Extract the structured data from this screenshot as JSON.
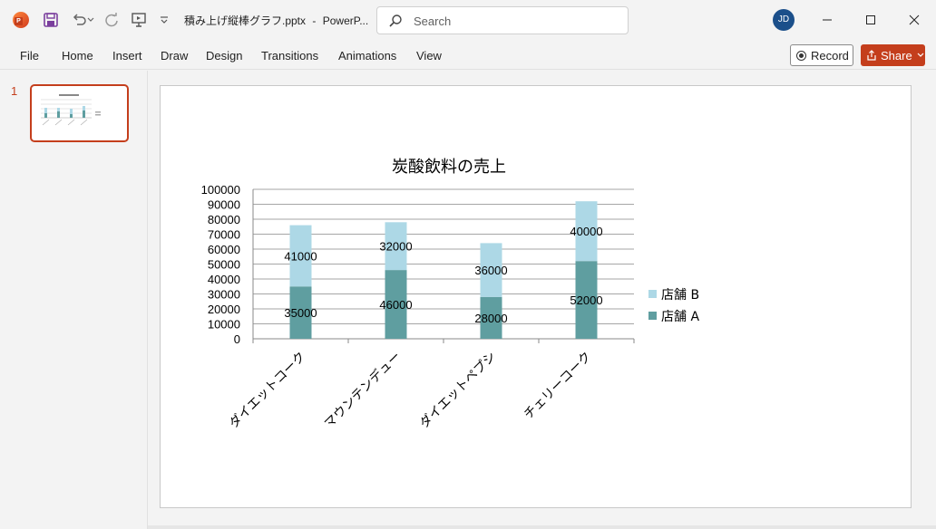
{
  "app": {
    "file_name": "積み上げ縦棒グラフ.pptx",
    "separator": "-",
    "app_name": "PowerP...",
    "user_initials": "JD"
  },
  "search": {
    "placeholder": "Search"
  },
  "ribbon": {
    "tabs": [
      "File",
      "Home",
      "Insert",
      "Draw",
      "Design",
      "Transitions",
      "Animations",
      "View"
    ],
    "record_label": "Record",
    "share_label": "Share"
  },
  "thumbnails": [
    {
      "number": "1"
    }
  ],
  "colors": {
    "accent": "#c43e1c",
    "series_a": "#5f9ea0",
    "series_b": "#add8e6"
  },
  "chart_data": {
    "type": "bar",
    "stacked": true,
    "title": "炭酸飲料の売上",
    "categories": [
      "ダイエットコーク",
      "マウンテンデュー",
      "ダイエットペプシ",
      "チェリーコーク"
    ],
    "series": [
      {
        "name": "店舗 A",
        "color": "#5f9ea0",
        "values": [
          35000,
          46000,
          28000,
          52000
        ]
      },
      {
        "name": "店舗 B",
        "color": "#add8e6",
        "values": [
          41000,
          32000,
          36000,
          40000
        ]
      }
    ],
    "ylim": [
      0,
      100000
    ],
    "yticks": [
      "0",
      "10000",
      "20000",
      "30000",
      "40000",
      "50000",
      "60000",
      "70000",
      "80000",
      "90000",
      "100000"
    ],
    "grid": true,
    "legend": "right"
  }
}
